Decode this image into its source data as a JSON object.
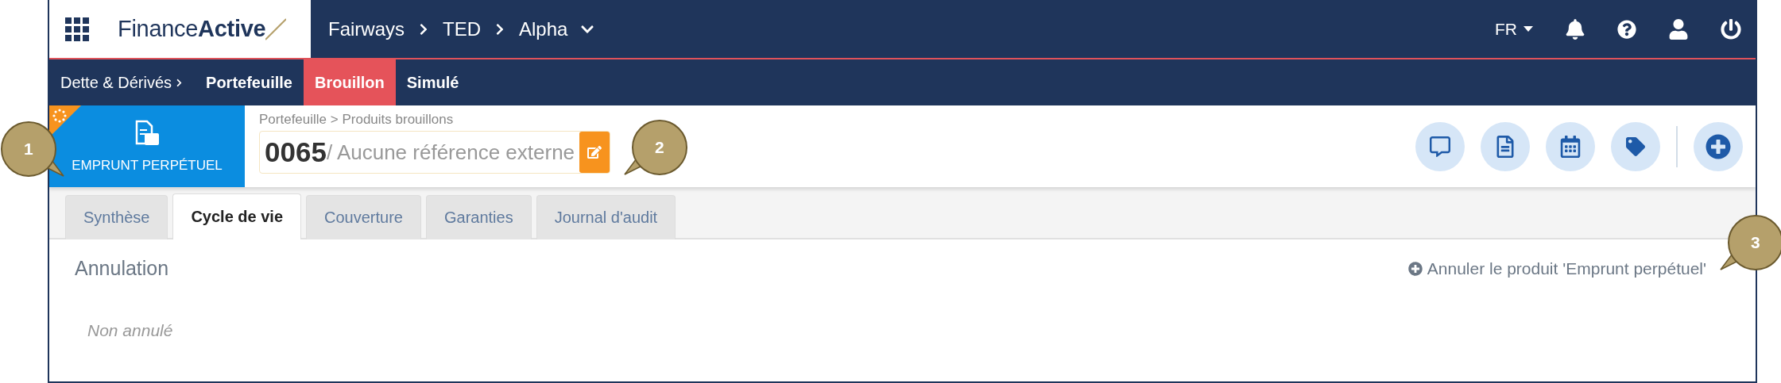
{
  "header": {
    "logo": {
      "regular": "Finance",
      "bold": "Active"
    },
    "breadcrumb": [
      {
        "label": "Fairways"
      },
      {
        "label": "TED"
      },
      {
        "label": "Alpha"
      }
    ],
    "language": "FR"
  },
  "nav": {
    "section": "Dette & Dérivés",
    "items": [
      {
        "label": "Portefeuille",
        "selected": false
      },
      {
        "label": "Brouillon",
        "selected": true
      },
      {
        "label": "Simulé",
        "selected": false
      }
    ]
  },
  "product": {
    "type_label": "EMPRUNT PERPÉTUEL",
    "breadcrumb": "Portefeuille > Produits brouillons",
    "number": "0065",
    "reference": "/ Aucune référence externe"
  },
  "tabs": [
    {
      "label": "Synthèse",
      "selected": false
    },
    {
      "label": "Cycle de vie",
      "selected": true
    },
    {
      "label": "Couverture",
      "selected": false
    },
    {
      "label": "Garanties",
      "selected": false
    },
    {
      "label": "Journal d'audit",
      "selected": false
    }
  ],
  "section": {
    "title": "Annulation",
    "action": "Annuler le produit 'Emprunt perpétuel'",
    "status": "Non annulé"
  },
  "callouts": [
    {
      "label": "1"
    },
    {
      "label": "2"
    },
    {
      "label": "3"
    }
  ]
}
